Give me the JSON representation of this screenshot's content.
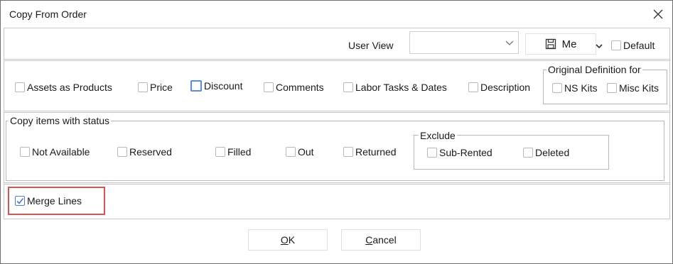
{
  "window": {
    "title": "Copy From Order",
    "close_label": "×"
  },
  "user_view": {
    "label": "User View",
    "combo_value": "",
    "me_label": "Me",
    "default_label": "Default"
  },
  "options": {
    "assets_as_products": "Assets as Products",
    "price": "Price",
    "discount": "Discount",
    "comments": "Comments",
    "labor_tasks_dates": "Labor Tasks & Dates",
    "description": "Description"
  },
  "original_definition": {
    "legend": "Original Definition for",
    "ns_kits": "NS Kits",
    "misc_kits": "Misc Kits"
  },
  "copy_status": {
    "legend": "Copy items with status",
    "not_available": "Not Available",
    "reserved": "Reserved",
    "filled": "Filled",
    "out": "Out",
    "returned": "Returned"
  },
  "exclude": {
    "legend": "Exclude",
    "sub_rented": "Sub-Rented",
    "deleted": "Deleted"
  },
  "merge_lines": {
    "label": "Merge Lines",
    "checked": true
  },
  "buttons": {
    "ok_prefix": "",
    "ok_underlined": "O",
    "ok_rest": "K",
    "cancel_underlined": "C",
    "cancel_rest": "ancel"
  },
  "colors": {
    "highlight": "#d9534f",
    "checkbox_accent": "#4a7fd0",
    "focus_accent": "#5a8fd6"
  },
  "icons": {
    "close": "close-icon",
    "chevron": "chevron-down-icon",
    "save": "save-icon",
    "check": "check-icon"
  }
}
